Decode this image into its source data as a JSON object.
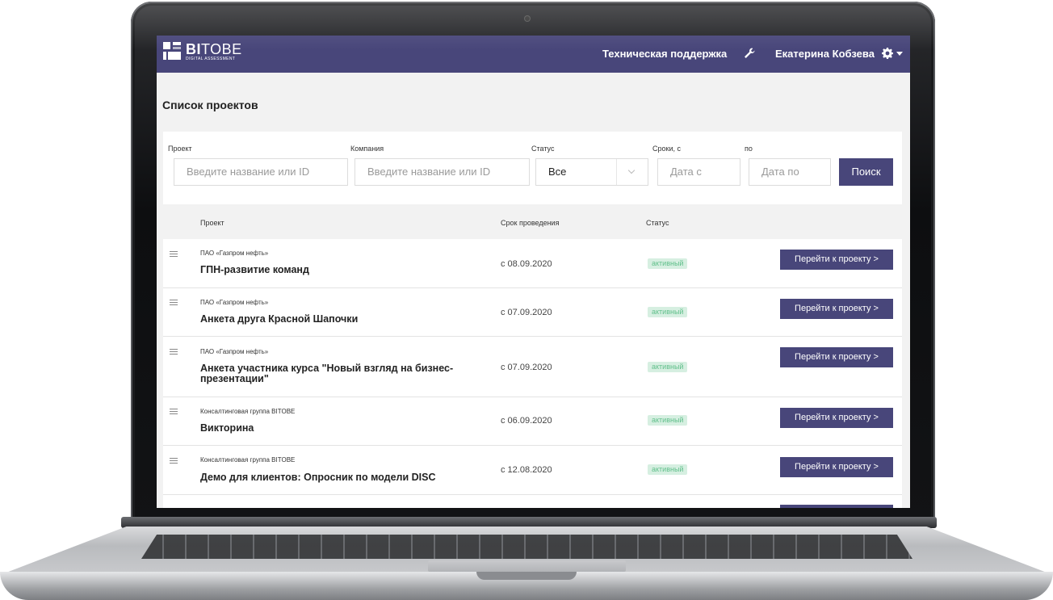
{
  "app": {
    "logo_main": "BI",
    "logo_main2": "TOBE",
    "logo_sub": "DIGITAL ASSESSMENT",
    "support_label": "Техническая поддержка",
    "user_name": "Екатерина Кобзева",
    "accent_color": "#48467a"
  },
  "page": {
    "title": "Список проектов"
  },
  "filters": {
    "project_label": "Проект",
    "project_placeholder": "Введите название или ID",
    "company_label": "Компания",
    "company_placeholder": "Введите название или ID",
    "status_label": "Статус",
    "status_value": "Все",
    "date_from_label": "Сроки, с",
    "date_from_placeholder": "Дата с",
    "date_to_label": "по",
    "date_to_placeholder": "Дата по",
    "search_label": "Поиск"
  },
  "table": {
    "columns": [
      "Проект",
      "Срок проведения",
      "Статус"
    ],
    "rows": [
      {
        "company": "ПАО «Газпром нефть»",
        "name": "ГПН-развитие команд",
        "date": "с 08.09.2020",
        "status": "активный",
        "action": "Перейти к проекту  >"
      },
      {
        "company": "ПАО «Газпром нефть»",
        "name": "Анкета друга Красной Шапочки",
        "date": "с 07.09.2020",
        "status": "активный",
        "action": "Перейти к проекту  >"
      },
      {
        "company": "ПАО «Газпром нефть»",
        "name": "Анкета участника курса \"Новый взгляд на бизнес-презентации\"",
        "date": "с 07.09.2020",
        "status": "активный",
        "action": "Перейти к проекту  >"
      },
      {
        "company": "Консалтинговая группа BITOBE",
        "name": "Викторина",
        "date": "с 06.09.2020",
        "status": "активный",
        "action": "Перейти к проекту  >"
      },
      {
        "company": "Консалтинговая группа BITOBE",
        "name": "Демо для клиентов: Опросник по модели DISC",
        "date": "с 12.08.2020",
        "status": "активный",
        "action": "Перейти к проекту  >"
      }
    ]
  }
}
